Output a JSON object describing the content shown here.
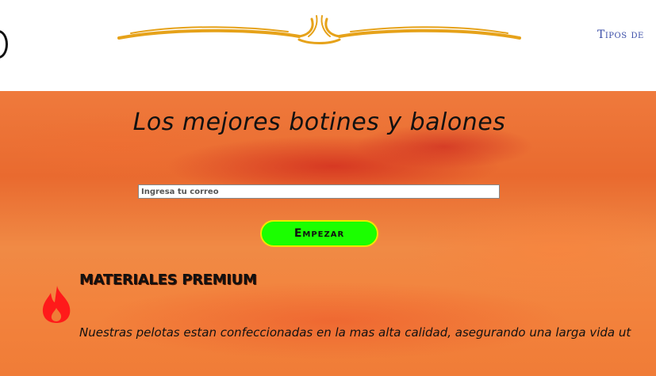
{
  "header": {
    "nav_link": "Tipos de"
  },
  "hero": {
    "title": "Los mejores botines y balones",
    "email_placeholder": "Ingresa tu correo",
    "cta_label": "Empezar"
  },
  "feature": {
    "icon": "fire-icon",
    "title": "MATERIALES PREMIUM",
    "text": "Nuestras pelotas estan confeccionadas en la mas alta calidad, asegurando una larga vida ut"
  },
  "colors": {
    "cta_background": "#1bff00",
    "cta_border": "#f5e400",
    "ornament": "#e6a21a",
    "nav_link": "#3b4ea8",
    "fire_icon": "#ff1a1a"
  }
}
